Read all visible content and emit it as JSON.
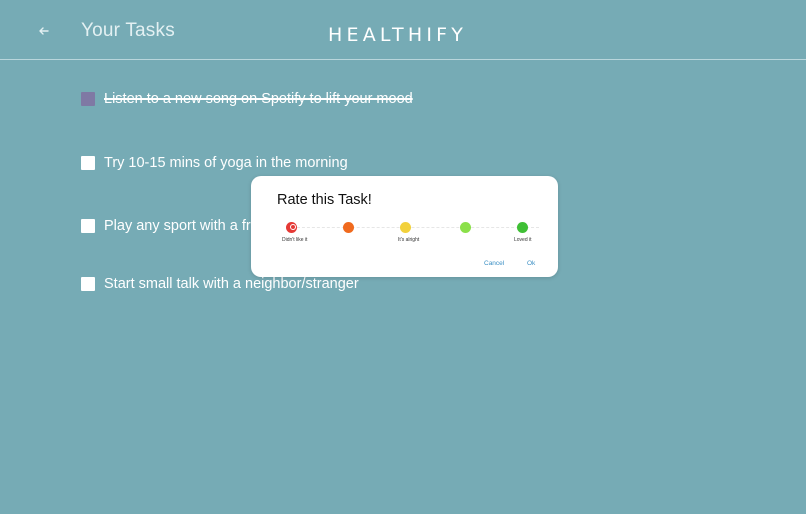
{
  "header": {
    "back_icon": "arrow-left-icon",
    "title": "Your Tasks",
    "brand": "HEALTHIFY"
  },
  "tasks": [
    {
      "label": "Listen to a new song on Spotify to lift your mood",
      "checked": true
    },
    {
      "label": "Try 10-15 mins of yoga in the morning",
      "checked": false
    },
    {
      "label": "Play any sport with a friend",
      "checked": false
    },
    {
      "label": "Start small talk with a neighbor/stranger",
      "checked": false
    }
  ],
  "dialog": {
    "title": "Rate this Task!",
    "ratings": [
      {
        "color": "#e53935",
        "caption": "Didn't like it",
        "selected": true
      },
      {
        "color": "#f06a1e",
        "caption": "",
        "selected": false
      },
      {
        "color": "#f2d13c",
        "caption": "It's alright",
        "selected": false
      },
      {
        "color": "#8be04a",
        "caption": "",
        "selected": false
      },
      {
        "color": "#3fbf35",
        "caption": "Loved it",
        "selected": false
      }
    ],
    "cancel_label": "Cancel",
    "ok_label": "Ok"
  },
  "colors": {
    "background": "#76abb5",
    "checked_box": "#7f79a4",
    "dialog_button": "#3b8fc4"
  }
}
